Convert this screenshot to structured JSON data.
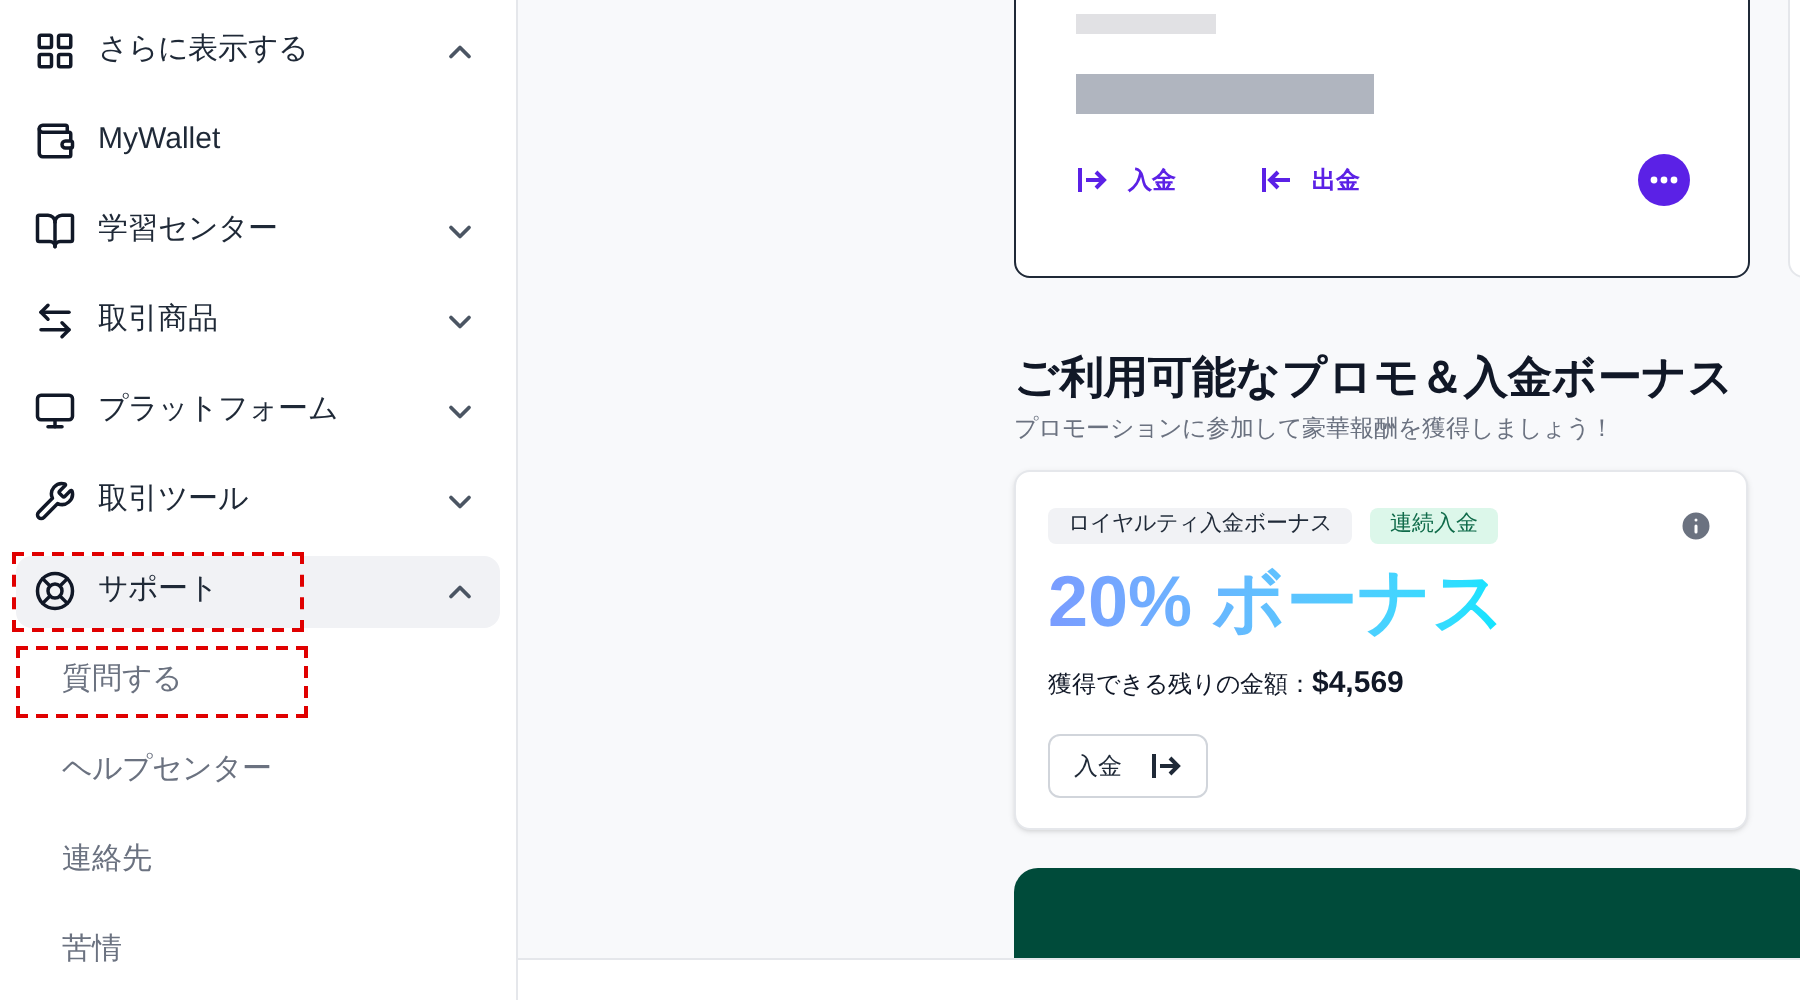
{
  "sidebar": {
    "items": [
      {
        "label": "さらに表示する",
        "kind": "group",
        "expanded": true,
        "selected": false,
        "highlighted": false
      },
      {
        "label": "MyWallet",
        "kind": "link",
        "selected": false,
        "highlighted": false
      },
      {
        "label": "学習センター",
        "kind": "group",
        "expanded": false,
        "selected": false,
        "highlighted": false
      },
      {
        "label": "取引商品",
        "kind": "group",
        "expanded": false,
        "selected": false,
        "highlighted": false
      },
      {
        "label": "プラットフォーム",
        "kind": "group",
        "expanded": false,
        "selected": false,
        "highlighted": false
      },
      {
        "label": "取引ツール",
        "kind": "group",
        "expanded": false,
        "selected": false,
        "highlighted": false
      },
      {
        "label": "サポート",
        "kind": "group",
        "expanded": true,
        "selected": true,
        "highlighted": true,
        "children": [
          {
            "label": "質問する",
            "highlighted": true
          },
          {
            "label": "ヘルプセンター",
            "highlighted": false
          },
          {
            "label": "連絡先",
            "highlighted": false
          },
          {
            "label": "苦情",
            "highlighted": false
          }
        ]
      }
    ]
  },
  "account_card": {
    "actions": [
      {
        "label": "入金",
        "kind": "deposit"
      },
      {
        "label": "出金",
        "kind": "withdraw"
      }
    ]
  },
  "promos": {
    "title": "ご利用可能なプロモ＆入金ボーナス",
    "subtitle": "プロモーションに参加して豪華報酬を獲得しましょう！",
    "cards": [
      {
        "tags": [
          {
            "label": "ロイヤルティ入金ボーナス",
            "kind": "neutral"
          },
          {
            "label": "連続入金",
            "kind": "success"
          }
        ],
        "headline": "20% ボーナス",
        "amount_label": "獲得できる残りの金額：",
        "amount": "$4,569",
        "button": "入金"
      }
    ]
  }
}
